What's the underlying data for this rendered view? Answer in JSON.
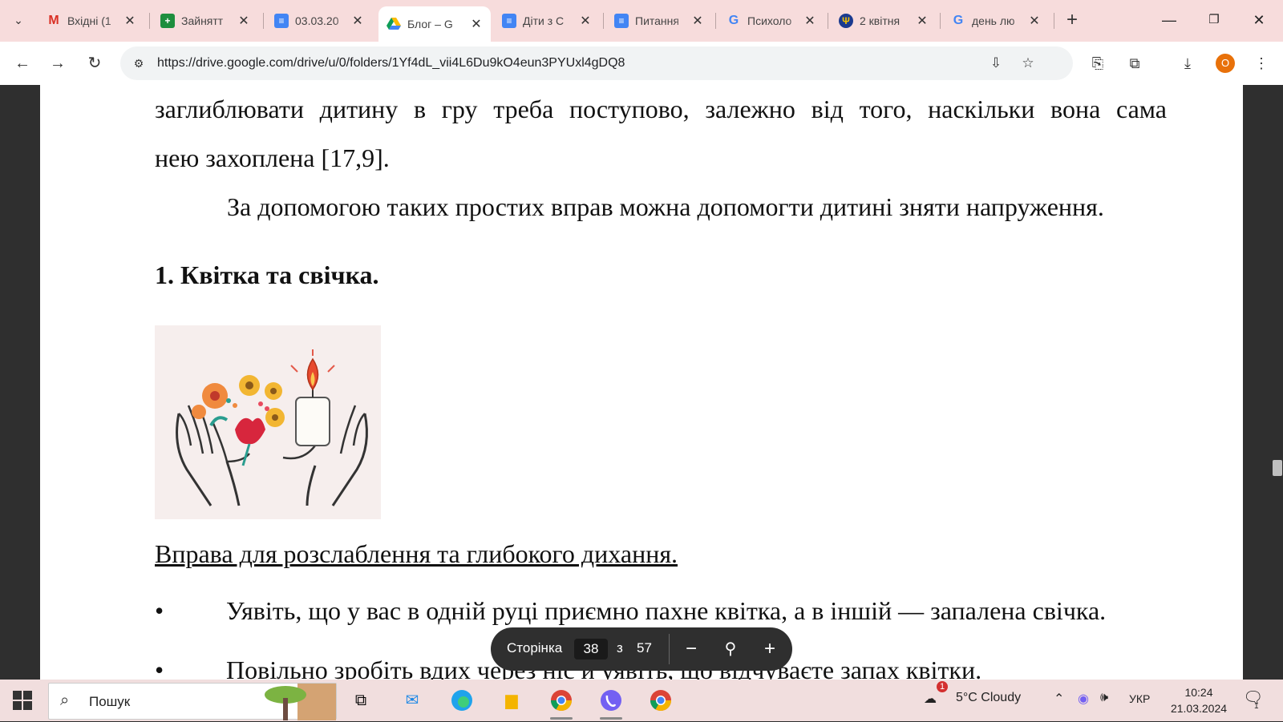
{
  "browser": {
    "tabs": [
      {
        "title": "Вхідні (1",
        "favicon": "gmail-icon",
        "active": false
      },
      {
        "title": "Зайнятт",
        "favicon": "sheets-icon",
        "active": false
      },
      {
        "title": "03.03.20",
        "favicon": "docs-icon",
        "active": false
      },
      {
        "title": "Блог – G",
        "favicon": "drive-icon",
        "active": true
      },
      {
        "title": "Діти з С",
        "favicon": "docs-icon",
        "active": false
      },
      {
        "title": "Питання",
        "favicon": "docs-icon",
        "active": false
      },
      {
        "title": "Психоло",
        "favicon": "google-icon",
        "active": false
      },
      {
        "title": "2 квітня",
        "favicon": "trident-icon",
        "active": false
      },
      {
        "title": "день лю",
        "favicon": "google-icon",
        "active": false
      }
    ],
    "url": "https://drive.google.com/drive/u/0/folders/1Yf4dL_vii4L6Du9kO4eun3PYUxl4gDQ8",
    "profile_initial": "O"
  },
  "document": {
    "para1_line1": "заглиблювати дитину в гру треба поступово, залежно від того, наскільки вона сама",
    "para1_line2": "нею захоплена [17,9].",
    "para2": "За допомогою таких простих вправ можна допомогти дитині зняти напруження.",
    "heading": "1. Квітка та свічка.",
    "subheading": "Вправа для розслаблення та глибокого дихання.",
    "bullet_symbol": "•",
    "bullet1": "Уявіть, що у вас в одній руці приємно пахне квітка, а в іншій — запалена свічка.",
    "bullet2": "Повільно зробіть вдих через ніс й уявіть, що відчуваєте запах квітки."
  },
  "page_control": {
    "label": "Сторінка",
    "current": "38",
    "of": "з",
    "total": "57"
  },
  "taskbar": {
    "search_placeholder": "Пошук",
    "weather": "5°C  Cloudy",
    "weather_badge": "1",
    "language": "УКР",
    "time": "10:24",
    "date": "21.03.2024",
    "notifications": "1"
  }
}
